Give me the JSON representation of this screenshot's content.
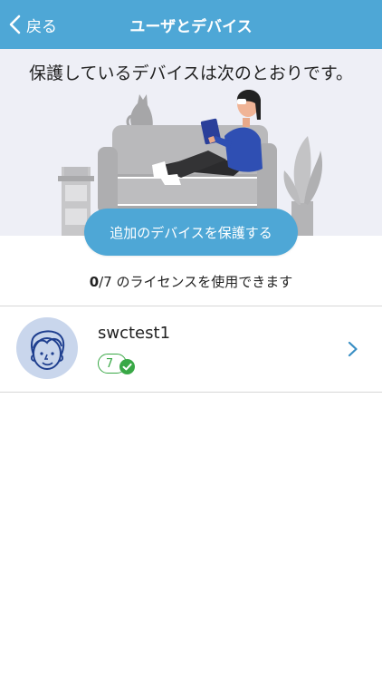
{
  "nav": {
    "back_label": "戻る",
    "title": "ユーザとデバイス"
  },
  "hero": {
    "heading": "保護しているデバイスは次のとおりです。"
  },
  "actions": {
    "add_device_label": "追加のデバイスを保護する"
  },
  "license": {
    "used": "0",
    "total_text": "/7 のライセンスを使用できます"
  },
  "users": [
    {
      "name": "swctest1",
      "device_count": "7",
      "status": "protected"
    }
  ],
  "colors": {
    "accent": "#4ea7d6",
    "success": "#39a846",
    "avatar_bg": "#c9d6ec",
    "hero_bg": "#eeeff6"
  },
  "icons": {
    "back": "chevron-left-icon",
    "row_chevron": "chevron-right-icon",
    "badge": "check-circle-icon",
    "avatar": "person-face-icon"
  }
}
